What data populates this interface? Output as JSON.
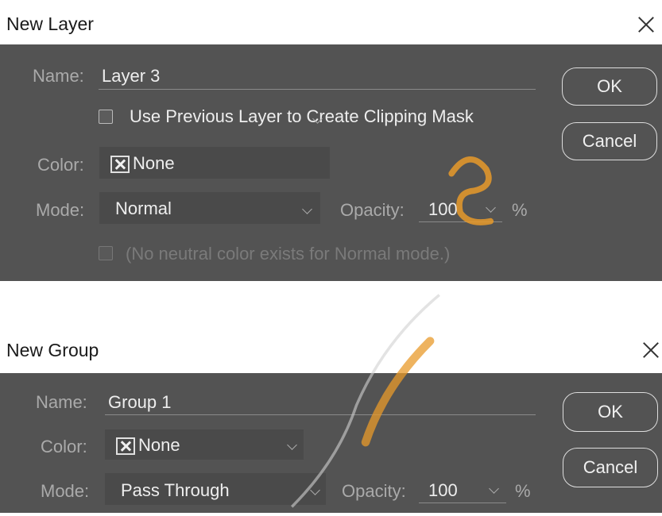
{
  "new_layer": {
    "title": "New Layer",
    "name_label": "Name:",
    "name_value": "Layer 3",
    "clip_label": "Use Previous Layer to Create Clipping Mask",
    "color_label": "Color:",
    "color_value": "None",
    "mode_label": "Mode:",
    "mode_value": "Normal",
    "opacity_label": "Opacity:",
    "opacity_value": "100",
    "opacity_unit": "%",
    "neutral_text": "(No neutral color exists for Normal mode.)",
    "ok_label": "OK",
    "cancel_label": "Cancel"
  },
  "new_group": {
    "title": "New Group",
    "name_label": "Name:",
    "name_value": "Group 1",
    "color_label": "Color:",
    "color_value": "None",
    "mode_label": "Mode:",
    "mode_value": "Pass Through",
    "opacity_label": "Opacity:",
    "opacity_value": "100",
    "opacity_unit": "%",
    "ok_label": "OK",
    "cancel_label": "Cancel"
  },
  "icons": {
    "close": "close-icon",
    "dropdown": "chevron-down-icon",
    "color_none": "x-box-icon"
  },
  "colors": {
    "panel_bg": "#535353",
    "field_bg": "#4a4a4a",
    "text": "#eeeeee",
    "label": "#aaaaaa"
  }
}
